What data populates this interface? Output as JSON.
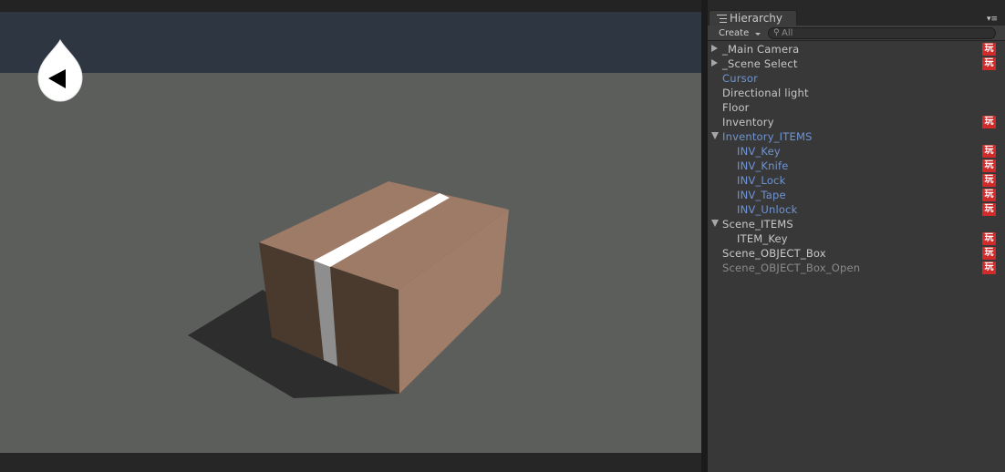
{
  "hierarchy": {
    "tab_label": "Hierarchy",
    "create_label": "Create",
    "search_placeholder": "All",
    "menu_glyph": "▾≡",
    "items": [
      {
        "label": "_Main Camera",
        "color": "#c8c8c8",
        "indent": 0,
        "expander": "collapsed",
        "badge": "玩"
      },
      {
        "label": "_Scene Select",
        "color": "#c8c8c8",
        "indent": 0,
        "expander": "collapsed",
        "badge": "玩"
      },
      {
        "label": "Cursor",
        "color": "#6e95d4",
        "indent": 0,
        "expander": "none",
        "badge": ""
      },
      {
        "label": "Directional light",
        "color": "#c8c8c8",
        "indent": 0,
        "expander": "none",
        "badge": ""
      },
      {
        "label": "Floor",
        "color": "#c8c8c8",
        "indent": 0,
        "expander": "none",
        "badge": ""
      },
      {
        "label": "Inventory",
        "color": "#c8c8c8",
        "indent": 0,
        "expander": "none",
        "badge": "玩"
      },
      {
        "label": "Inventory_ITEMS",
        "color": "#6e95d4",
        "indent": 0,
        "expander": "expanded",
        "badge": ""
      },
      {
        "label": "INV_Key",
        "color": "#6e95d4",
        "indent": 1,
        "expander": "none",
        "badge": "玩"
      },
      {
        "label": "INV_Knife",
        "color": "#6e95d4",
        "indent": 1,
        "expander": "none",
        "badge": "玩"
      },
      {
        "label": "INV_Lock",
        "color": "#6e95d4",
        "indent": 1,
        "expander": "none",
        "badge": "玩"
      },
      {
        "label": "INV_Tape",
        "color": "#6e95d4",
        "indent": 1,
        "expander": "none",
        "badge": "玩"
      },
      {
        "label": "INV_Unlock",
        "color": "#6e95d4",
        "indent": 1,
        "expander": "none",
        "badge": "玩"
      },
      {
        "label": "Scene_ITEMS",
        "color": "#c8c8c8",
        "indent": 0,
        "expander": "expanded",
        "badge": ""
      },
      {
        "label": "ITEM_Key",
        "color": "#c8c8c8",
        "indent": 1,
        "expander": "none",
        "badge": "玩"
      },
      {
        "label": "Scene_OBJECT_Box",
        "color": "#c8c8c8",
        "indent": 0,
        "expander": "none",
        "badge": "玩"
      },
      {
        "label": "Scene_OBJECT_Box_Open",
        "color": "#8a8a8a",
        "indent": 0,
        "expander": "none",
        "badge": "玩"
      }
    ]
  },
  "scene": {
    "back_button_icon": "back-arrow-icon",
    "colors": {
      "sky": "#2e3641",
      "ground": "#5c5e5c",
      "shadow": "#2d2d2d",
      "box_top": "#9e7b66",
      "box_front": "#4a3a2e",
      "box_side": "#a07d68",
      "tape": "#ffffff",
      "tape_shaded": "#8e8e8e",
      "badge": "#d12a2a"
    }
  }
}
